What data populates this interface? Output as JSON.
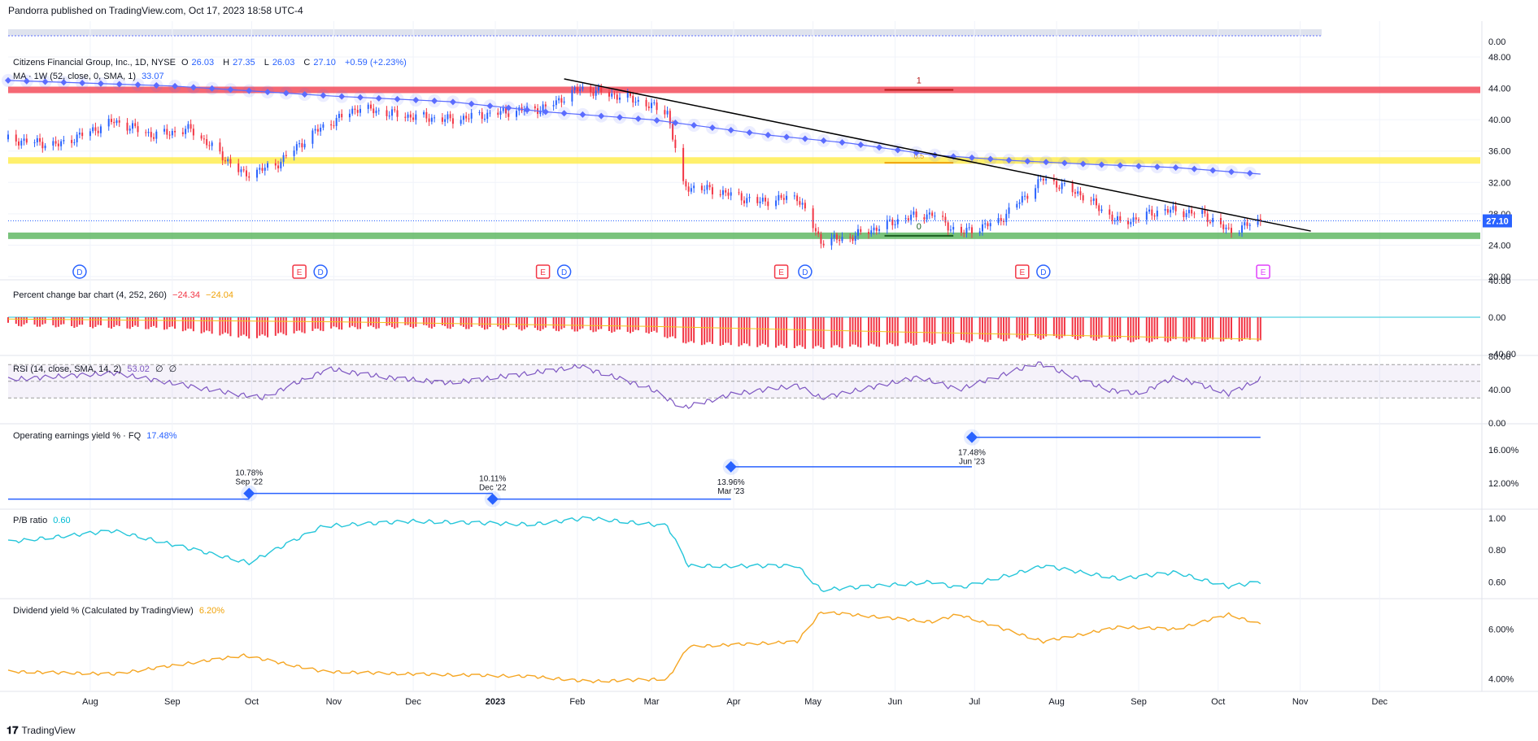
{
  "header": {
    "publisher": "Pandorra published on TradingView.com, Oct 17, 2023 18:58 UTC-4"
  },
  "footer": {
    "brand": "TradingView"
  },
  "symbol": {
    "name": "Citizens Financial Group, Inc., 1D, NYSE",
    "o_label": "O",
    "o": "26.03",
    "h_label": "H",
    "h": "27.35",
    "l_label": "L",
    "l": "26.03",
    "c_label": "C",
    "c": "27.10",
    "change": "+0.59 (+2.23%)",
    "last_price_tag": "27.10"
  },
  "ma_legend": {
    "label": "MA · 1W (52, close, 0, SMA, 1)",
    "value": "33.07"
  },
  "pct_legend": {
    "label": "Percent change bar chart (4, 252, 260)",
    "v1": "−24.34",
    "v2": "−24.04"
  },
  "rsi_legend": {
    "label": "RSI (14, close, SMA, 14, 2)",
    "v1": "53.02",
    "v2": "∅",
    "v3": "∅"
  },
  "oey_legend": {
    "label": "Operating earnings yield % · FQ",
    "value": "17.48%"
  },
  "pb_legend": {
    "label": "P/B ratio",
    "value": "0.60"
  },
  "div_legend": {
    "label": "Dividend yield % (Calculated by TradingView)",
    "value": "6.20%"
  },
  "fib": {
    "top_label": "1",
    "bottom_label": "0",
    "mid_label": "0.5"
  },
  "events": [
    {
      "t": "D",
      "x": "2022-07-28"
    },
    {
      "t": "E",
      "x": "2022-10-19"
    },
    {
      "t": "D",
      "x": "2022-10-27"
    },
    {
      "t": "E",
      "x": "2023-01-19"
    },
    {
      "t": "D",
      "x": "2023-01-27"
    },
    {
      "t": "E",
      "x": "2023-04-19"
    },
    {
      "t": "D",
      "x": "2023-04-28"
    },
    {
      "t": "E",
      "x": "2023-07-19"
    },
    {
      "t": "D",
      "x": "2023-07-27"
    },
    {
      "t": "E",
      "x": "2023-10-18"
    }
  ],
  "colors": {
    "up": "#2962ff",
    "down": "#f23645",
    "ma": "#5b6cff",
    "trend": "#000000",
    "band_red": "#f23645",
    "band_yellow": "#ffeb3b",
    "band_green": "#4caf50",
    "pct_bar": "#f23645",
    "rsi": "#7e57c2",
    "oey": "#2962ff",
    "pb": "#26c6da",
    "div": "#f5a623"
  },
  "chart_data": [
    {
      "type": "candlestick",
      "title": "Citizens Financial Group, Inc., 1D, NYSE",
      "x_ticks": [
        "Aug",
        "Sep",
        "Oct",
        "Nov",
        "Dec",
        "2023",
        "Feb",
        "Mar",
        "Apr",
        "May",
        "Jun",
        "Jul",
        "Aug",
        "Sep",
        "Oct",
        "Nov",
        "Dec"
      ],
      "x_tick_dates": [
        "2022-08-01",
        "2022-09-01",
        "2022-10-01",
        "2022-11-01",
        "2022-12-01",
        "2023-01-01",
        "2023-02-01",
        "2023-03-01",
        "2023-04-01",
        "2023-05-01",
        "2023-06-01",
        "2023-07-01",
        "2023-08-01",
        "2023-09-01",
        "2023-10-01",
        "2023-11-01",
        "2023-12-01"
      ],
      "ylim": [
        20,
        48
      ],
      "y_ticks": [
        "48.00",
        "44.00",
        "40.00",
        "36.00",
        "32.00",
        "28.00",
        "24.00",
        "20.00"
      ],
      "close_path": [
        [
          "2022-07-01",
          37.5
        ],
        [
          "2022-07-20",
          36.8
        ],
        [
          "2022-08-10",
          39.8
        ],
        [
          "2022-08-25",
          38.0
        ],
        [
          "2022-09-08",
          38.8
        ],
        [
          "2022-09-28",
          33.0
        ],
        [
          "2022-10-10",
          34.2
        ],
        [
          "2022-10-25",
          38.5
        ],
        [
          "2022-11-10",
          41.5
        ],
        [
          "2022-11-28",
          40.5
        ],
        [
          "2022-12-15",
          40.0
        ],
        [
          "2023-01-05",
          41.0
        ],
        [
          "2023-01-20",
          41.5
        ],
        [
          "2023-02-02",
          44.0
        ],
        [
          "2023-02-20",
          42.8
        ],
        [
          "2023-03-07",
          41.0
        ],
        [
          "2023-03-13",
          31.5
        ],
        [
          "2023-03-25",
          31.0
        ],
        [
          "2023-04-10",
          29.5
        ],
        [
          "2023-04-25",
          30.2
        ],
        [
          "2023-05-04",
          24.5
        ],
        [
          "2023-05-15",
          25.0
        ],
        [
          "2023-06-05",
          27.5
        ],
        [
          "2023-06-15",
          28.0
        ],
        [
          "2023-06-25",
          25.5
        ],
        [
          "2023-07-10",
          27.0
        ],
        [
          "2023-07-27",
          32.5
        ],
        [
          "2023-08-10",
          30.5
        ],
        [
          "2023-08-25",
          26.8
        ],
        [
          "2023-09-10",
          28.5
        ],
        [
          "2023-09-25",
          28.0
        ],
        [
          "2023-10-05",
          25.8
        ],
        [
          "2023-10-17",
          27.1
        ]
      ],
      "ma_weekly": [
        [
          "2022-07-01",
          45.0
        ],
        [
          "2022-09-01",
          44.3
        ],
        [
          "2022-11-01",
          43.0
        ],
        [
          "2022-12-15",
          42.3
        ],
        [
          "2023-01-20",
          41.0
        ],
        [
          "2023-03-01",
          40.0
        ],
        [
          "2023-04-15",
          38.0
        ],
        [
          "2023-05-15",
          37.0
        ],
        [
          "2023-06-15",
          35.5
        ],
        [
          "2023-07-15",
          34.8
        ],
        [
          "2023-08-15",
          34.3
        ],
        [
          "2023-09-15",
          33.9
        ],
        [
          "2023-10-17",
          33.07
        ]
      ],
      "trendline": [
        [
          "2023-01-27",
          45.2
        ],
        [
          "2023-11-05",
          25.8
        ]
      ],
      "bands": [
        {
          "level": 43.8,
          "color": "red"
        },
        {
          "level": 34.8,
          "color": "yellow"
        },
        {
          "level": 25.2,
          "color": "green"
        }
      ]
    },
    {
      "type": "bar",
      "title": "Percent change bar chart (4, 252, 260)",
      "ylim": [
        -40,
        40
      ],
      "y_ticks": [
        "40.00",
        "0.00",
        "−40.00"
      ],
      "values_path": [
        [
          "2022-07-01",
          -8
        ],
        [
          "2022-09-01",
          -12
        ],
        [
          "2022-10-01",
          -22
        ],
        [
          "2022-11-01",
          -12
        ],
        [
          "2022-12-01",
          -10
        ],
        [
          "2023-01-01",
          -12
        ],
        [
          "2023-02-01",
          -14
        ],
        [
          "2023-03-01",
          -16
        ],
        [
          "2023-03-15",
          -28
        ],
        [
          "2023-05-01",
          -33
        ],
        [
          "2023-06-01",
          -30
        ],
        [
          "2023-07-01",
          -26
        ],
        [
          "2023-08-01",
          -22
        ],
        [
          "2023-09-01",
          -26
        ],
        [
          "2023-10-17",
          -24.34
        ]
      ]
    },
    {
      "type": "line",
      "title": "RSI (14, close, SMA, 14, 2)",
      "ylim": [
        0,
        80
      ],
      "y_ticks": [
        "80.00",
        "40.00",
        "0.00"
      ],
      "values_path": [
        [
          "2022-07-01",
          52
        ],
        [
          "2022-08-10",
          60
        ],
        [
          "2022-09-15",
          40
        ],
        [
          "2022-10-05",
          30
        ],
        [
          "2022-10-30",
          65
        ],
        [
          "2022-11-20",
          55
        ],
        [
          "2022-12-15",
          48
        ],
        [
          "2023-01-15",
          60
        ],
        [
          "2023-02-02",
          68
        ],
        [
          "2023-02-28",
          42
        ],
        [
          "2023-03-13",
          18
        ],
        [
          "2023-04-01",
          35
        ],
        [
          "2023-04-25",
          45
        ],
        [
          "2023-05-04",
          30
        ],
        [
          "2023-06-10",
          55
        ],
        [
          "2023-06-25",
          40
        ],
        [
          "2023-07-25",
          72
        ],
        [
          "2023-08-20",
          40
        ],
        [
          "2023-09-01",
          35
        ],
        [
          "2023-09-15",
          55
        ],
        [
          "2023-10-05",
          35
        ],
        [
          "2023-10-17",
          53.02
        ]
      ]
    },
    {
      "type": "step",
      "title": "Operating earnings yield % · FQ",
      "ylim": [
        9,
        19
      ],
      "y_ticks": [
        "16.00%",
        "12.00%"
      ],
      "points": [
        {
          "x": "2022-09-30",
          "y": 10.78,
          "label": "10.78%",
          "period": "Sep '22"
        },
        {
          "x": "2022-12-31",
          "y": 10.11,
          "label": "10.11%",
          "period": "Dec '22"
        },
        {
          "x": "2023-03-31",
          "y": 13.96,
          "label": "13.96%",
          "period": "Mar '23"
        },
        {
          "x": "2023-06-30",
          "y": 17.48,
          "label": "17.48%",
          "period": "Jun '23"
        }
      ]
    },
    {
      "type": "line",
      "title": "P/B ratio",
      "ylim": [
        0.5,
        1.05
      ],
      "y_ticks": [
        "1.00",
        "0.80",
        "0.60"
      ],
      "values_path": [
        [
          "2022-07-01",
          0.85
        ],
        [
          "2022-08-10",
          0.92
        ],
        [
          "2022-09-30",
          0.72
        ],
        [
          "2022-10-28",
          0.95
        ],
        [
          "2022-12-01",
          0.98
        ],
        [
          "2023-01-15",
          0.96
        ],
        [
          "2023-02-05",
          1.0
        ],
        [
          "2023-03-07",
          0.95
        ],
        [
          "2023-03-15",
          0.7
        ],
        [
          "2023-04-25",
          0.7
        ],
        [
          "2023-05-04",
          0.55
        ],
        [
          "2023-06-15",
          0.6
        ],
        [
          "2023-06-25",
          0.56
        ],
        [
          "2023-07-27",
          0.7
        ],
        [
          "2023-08-25",
          0.62
        ],
        [
          "2023-09-15",
          0.66
        ],
        [
          "2023-10-05",
          0.57
        ],
        [
          "2023-10-17",
          0.6
        ]
      ]
    },
    {
      "type": "line",
      "title": "Dividend yield % (Calculated by TradingView)",
      "ylim": [
        3.5,
        7.2
      ],
      "y_ticks": [
        "6.00%",
        "4.00%"
      ],
      "values_path": [
        [
          "2022-07-01",
          4.3
        ],
        [
          "2022-08-10",
          4.2
        ],
        [
          "2022-09-28",
          4.95
        ],
        [
          "2022-10-28",
          4.3
        ],
        [
          "2022-12-01",
          4.2
        ],
        [
          "2023-01-15",
          4.1
        ],
        [
          "2023-02-05",
          3.9
        ],
        [
          "2023-03-07",
          4.0
        ],
        [
          "2023-03-15",
          5.3
        ],
        [
          "2023-04-25",
          5.5
        ],
        [
          "2023-05-04",
          6.7
        ],
        [
          "2023-06-15",
          6.3
        ],
        [
          "2023-06-25",
          6.6
        ],
        [
          "2023-07-27",
          5.5
        ],
        [
          "2023-08-25",
          6.1
        ],
        [
          "2023-09-15",
          6.0
        ],
        [
          "2023-10-05",
          6.6
        ],
        [
          "2023-10-17",
          6.2
        ]
      ]
    }
  ]
}
